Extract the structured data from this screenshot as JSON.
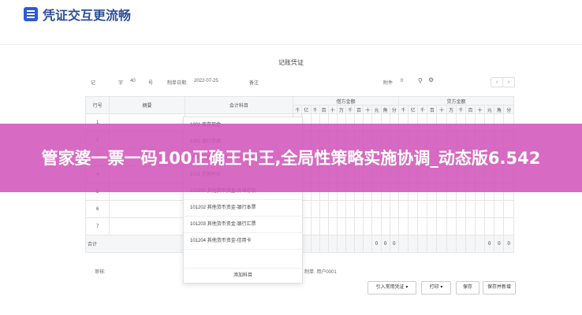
{
  "header": {
    "title": "凭证交互更流畅"
  },
  "document": {
    "title": "记账凭证"
  },
  "toolbar": {
    "voucher_word": "记",
    "number_label": "字",
    "number_value": "40",
    "number_unit": "号",
    "date_label": "制单日期",
    "date_value": "2022-07-25",
    "remark_label": "备注",
    "attachment_label": "附件",
    "attachment_value": "0"
  },
  "table": {
    "headers": {
      "row_no": "行号",
      "summary": "摘要",
      "account": "会计科目",
      "debit": "借方金额",
      "credit": "贷方金额"
    },
    "digit_headers": [
      "千",
      "亿",
      "千",
      "百",
      "十",
      "万",
      "千",
      "百",
      "十",
      "元",
      "角",
      "分"
    ],
    "rows": [
      "1",
      "2",
      "3",
      "4",
      "5",
      "6",
      "7"
    ],
    "total_label": "合计",
    "debit_total": [
      "0",
      "0",
      "0"
    ],
    "credit_total": [
      "0",
      "0",
      "0"
    ]
  },
  "dropdown": {
    "items": [
      "1001 库存现金",
      "1002 银行存款",
      "1003 存放中央银行款项",
      "1011 存放同业",
      "101201 其他货币资金-外埠存款",
      "101202 其他货币资金-银行本票",
      "101203 其他货币资金-银行汇票",
      "101204 其他货币资金-信用卡"
    ],
    "add_label": "添加科目"
  },
  "footer": {
    "audit_label": "审核:",
    "creator_label": "制单: 用户0001"
  },
  "buttons": {
    "import": "引入常用凭证",
    "print": "打印",
    "save": "保存",
    "save_new": "保存并新增"
  },
  "banner": {
    "text": "管家婆一票一码100正确王中王,全局性策略实施协调_动态版6.542"
  }
}
